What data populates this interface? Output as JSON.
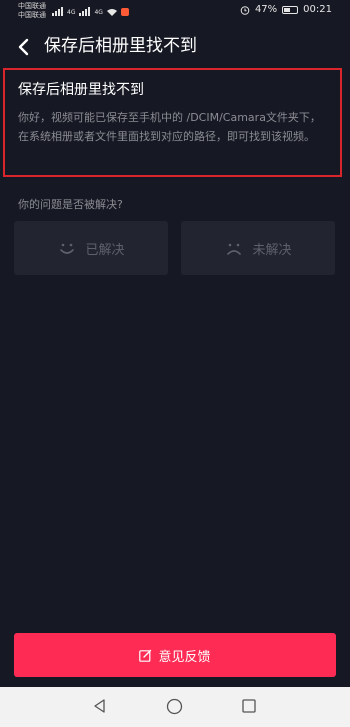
{
  "status_bar": {
    "carrier_1": "中国联通",
    "carrier_2": "中国联通",
    "net_1": "4G",
    "net_2": "4G",
    "battery": "47%",
    "time": "00:21"
  },
  "header": {
    "title": "保存后相册里找不到"
  },
  "answer": {
    "title": "保存后相册里找不到",
    "body": "你好，视频可能已保存至手机中的 /DCIM/Camara文件夹下，在系统相册或者文件里面找到对应的路径，即可找到该视频。"
  },
  "question": {
    "text": "你的问题是否被解决?",
    "solved_label": "已解决",
    "unsolved_label": "未解决"
  },
  "feedback": {
    "label": "意见反馈"
  },
  "colors": {
    "background": "#161823",
    "accent": "#fe2c55",
    "highlight_border": "#d9262c"
  }
}
